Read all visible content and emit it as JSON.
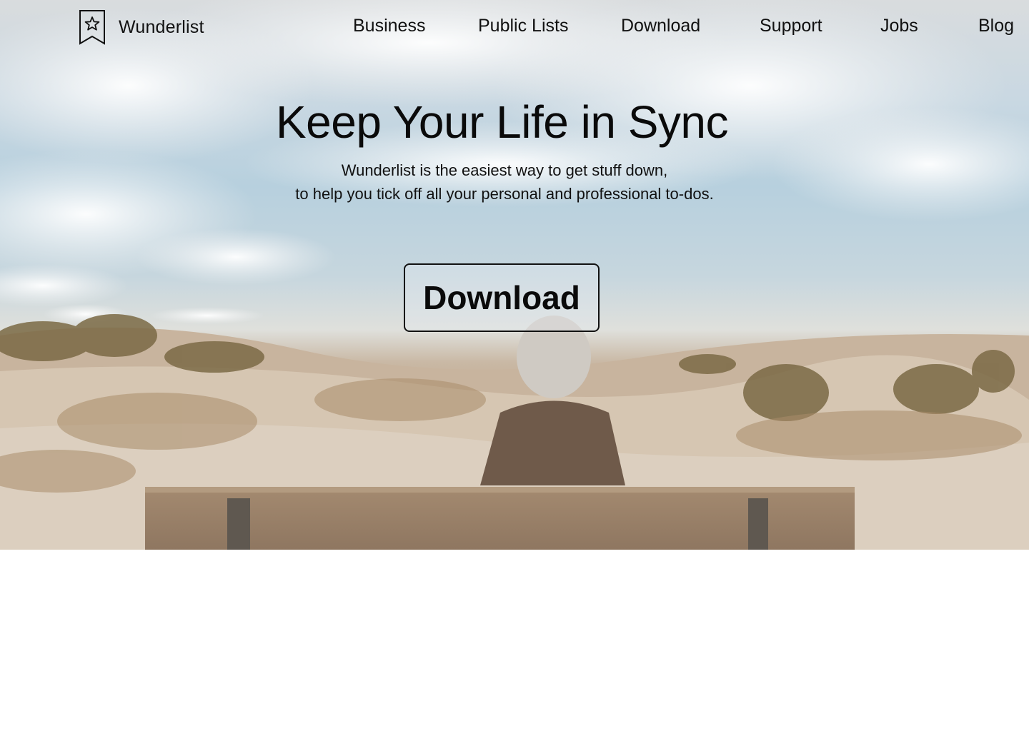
{
  "brand": {
    "name": "Wunderlist",
    "icon": "bookmark-star-icon"
  },
  "nav": {
    "items": [
      {
        "label": "Business"
      },
      {
        "label": "Public Lists"
      },
      {
        "label": "Download"
      },
      {
        "label": "Support"
      },
      {
        "label": "Jobs"
      },
      {
        "label": "Blog"
      }
    ]
  },
  "hero": {
    "headline": "Keep Your Life in Sync",
    "subline_1": "Wunderlist is the easiest way to get stuff down,",
    "subline_2": "to help you tick off all your personal and professional to-dos.",
    "cta_label": "Download",
    "image_subject": "person sitting on wooden bench facing sand dunes under cloudy sky"
  },
  "colors": {
    "text": "#0a0a0a",
    "sky": "#b7d0de",
    "sand": "#c9b8a4",
    "page_background": "#ffffff"
  }
}
